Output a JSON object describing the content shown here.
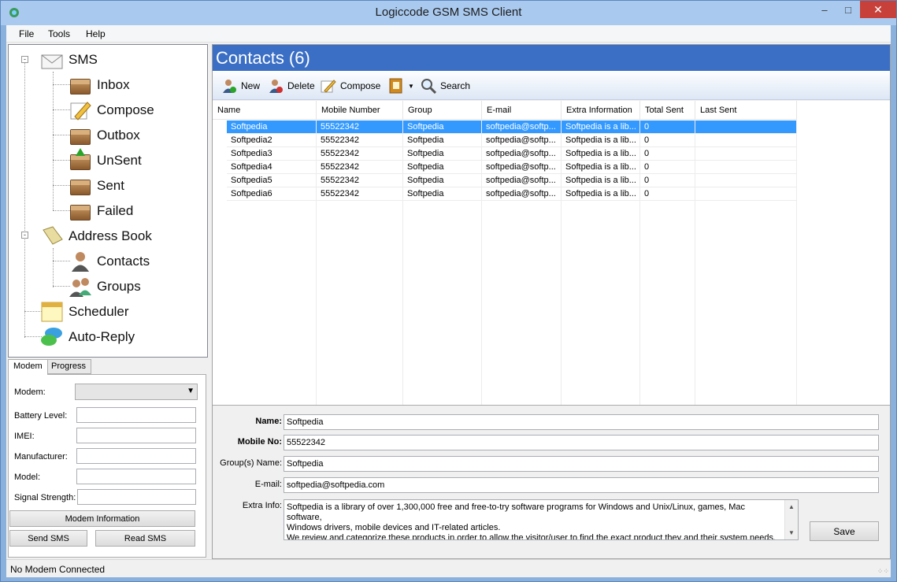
{
  "window": {
    "title": "Logiccode GSM SMS Client"
  },
  "menu": [
    "File",
    "Tools",
    "Help"
  ],
  "tree": {
    "sms": "SMS",
    "inbox": "Inbox",
    "compose": "Compose",
    "outbox": "Outbox",
    "unsent": "UnSent",
    "sent": "Sent",
    "failed": "Failed",
    "address_book": "Address Book",
    "contacts": "Contacts",
    "groups": "Groups",
    "scheduler": "Scheduler",
    "auto_reply": "Auto-Reply"
  },
  "modem_panel": {
    "tabs": [
      "Modem",
      "Progress"
    ],
    "modem_label": "Modem:",
    "battery_label": "Battery Level:",
    "imei_label": "IMEI:",
    "manufacturer_label": "Manufacturer:",
    "model_label": "Model:",
    "signal_label": "Signal Strength:",
    "modem_info_button": "Modem Information",
    "send_sms_button": "Send SMS",
    "read_sms_button": "Read SMS"
  },
  "status": {
    "text": "No Modem Connected"
  },
  "contacts": {
    "header": "Contacts (6)",
    "toolbar": {
      "new": "New",
      "delete": "Delete",
      "compose": "Compose",
      "search": "Search"
    },
    "columns": [
      "Name",
      "Mobile Number",
      "Group",
      "E-mail",
      "Extra Information",
      "Total Sent",
      "Last Sent"
    ],
    "rows": [
      [
        "Softpedia",
        "55522342",
        "Softpedia",
        "softpedia@softp...",
        "Softpedia is a lib...",
        "0",
        ""
      ],
      [
        "Softpedia2",
        "55522342",
        "Softpedia",
        "softpedia@softp...",
        "Softpedia is a lib...",
        "0",
        ""
      ],
      [
        "Softpedia3",
        "55522342",
        "Softpedia",
        "softpedia@softp...",
        "Softpedia is a lib...",
        "0",
        ""
      ],
      [
        "Softpedia4",
        "55522342",
        "Softpedia",
        "softpedia@softp...",
        "Softpedia is a lib...",
        "0",
        ""
      ],
      [
        "Softpedia5",
        "55522342",
        "Softpedia",
        "softpedia@softp...",
        "Softpedia is a lib...",
        "0",
        ""
      ],
      [
        "Softpedia6",
        "55522342",
        "Softpedia",
        "softpedia@softp...",
        "Softpedia is a lib...",
        "0",
        ""
      ]
    ]
  },
  "details": {
    "name_label": "Name:",
    "name_value": "Softpedia",
    "mobile_label": "Mobile No:",
    "mobile_value": "55522342",
    "groups_label": "Group(s) Name:",
    "groups_value": "Softpedia",
    "email_label": "E-mail:",
    "email_value": "softpedia@softpedia.com",
    "extra_label": "Extra Info:",
    "extra_line1": "Softpedia is a library of over 1,300,000 free and free-to-try software programs for Windows and Unix/Linux, games, Mac software,",
    "extra_line2": "Windows drivers, mobile devices and IT-related articles.",
    "extra_line3": "We review and categorize these products in order to allow the visitor/user to find the exact product they and their system needs.",
    "save_button": "Save"
  }
}
